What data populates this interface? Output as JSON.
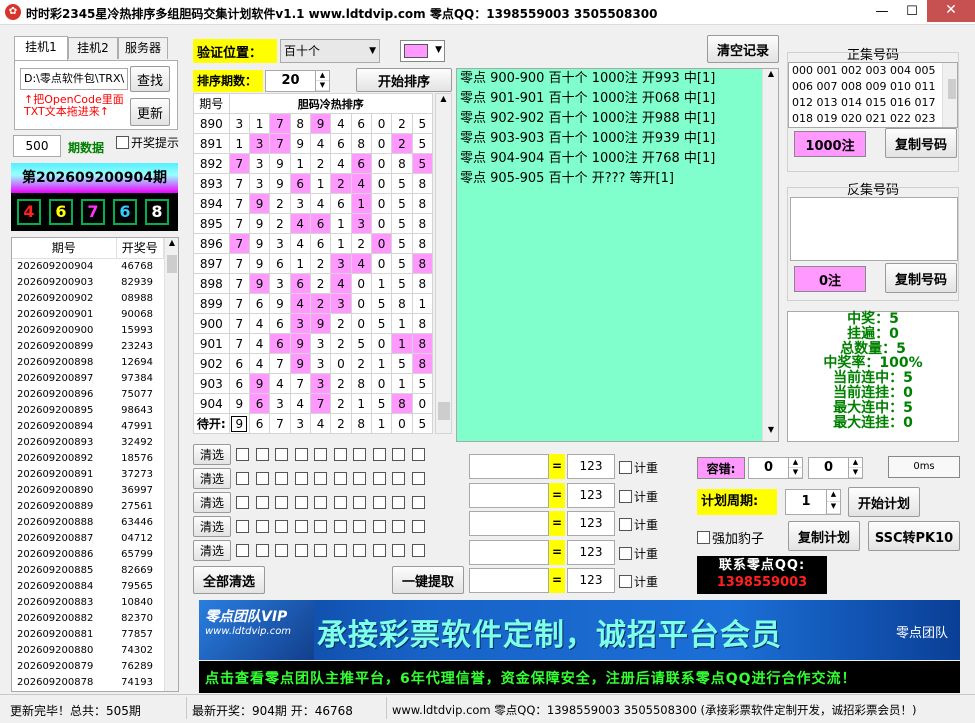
{
  "window": {
    "title": "时时彩2345星冷热排序多组胆码交集计划软件v1.1      www.ldtdvip.com      零点QQ：1398559003   3505508300",
    "app_icon": "app-logo-icon"
  },
  "left": {
    "tabs": [
      "挂机1",
      "挂机2",
      "服务器"
    ],
    "path": "D:\\零点软件包\\TRX\\",
    "find": "查找",
    "update": "更新",
    "hint1": "↑把OpenCode里面",
    "hint2": "TXT文本拖进来↑",
    "period_count": "500",
    "period_label": "期数据",
    "lottery_hint": "开奖提示",
    "current_issue": "第202609200904期",
    "digits": [
      {
        "d": "4",
        "c": "#ff2020"
      },
      {
        "d": "6",
        "c": "#ffff00"
      },
      {
        "d": "7",
        "c": "#ff33ff"
      },
      {
        "d": "6",
        "c": "#33ccff"
      },
      {
        "d": "8",
        "c": "#ffffff"
      }
    ],
    "hist_headers": [
      "期号",
      "开奖号"
    ],
    "history": [
      [
        "202609200904",
        "46768"
      ],
      [
        "202609200903",
        "82939"
      ],
      [
        "202609200902",
        "08988"
      ],
      [
        "202609200901",
        "90068"
      ],
      [
        "202609200900",
        "15993"
      ],
      [
        "202609200899",
        "23243"
      ],
      [
        "202609200898",
        "12694"
      ],
      [
        "202609200897",
        "97384"
      ],
      [
        "202609200896",
        "75077"
      ],
      [
        "202609200895",
        "98643"
      ],
      [
        "202609200894",
        "47991"
      ],
      [
        "202609200893",
        "32492"
      ],
      [
        "202609200892",
        "18576"
      ],
      [
        "202609200891",
        "37273"
      ],
      [
        "202609200890",
        "36997"
      ],
      [
        "202609200889",
        "27561"
      ],
      [
        "202609200888",
        "63446"
      ],
      [
        "202609200887",
        "04712"
      ],
      [
        "202609200886",
        "65799"
      ],
      [
        "202609200885",
        "82669"
      ],
      [
        "202609200884",
        "79565"
      ],
      [
        "202609200883",
        "10840"
      ],
      [
        "202609200882",
        "82370"
      ],
      [
        "202609200881",
        "77857"
      ],
      [
        "202609200880",
        "74302"
      ],
      [
        "202609200879",
        "76289"
      ],
      [
        "202609200878",
        "74193"
      ]
    ]
  },
  "mid": {
    "verify_label": "验证位置：",
    "verify_value": "百十个",
    "sort_label": "排序期数：",
    "sort_value": "20",
    "start_sort": "开始排序",
    "col_period": "期号",
    "col_title": "胆码冷热排序",
    "rows": [
      {
        "p": "890",
        "d": [
          "3",
          "1",
          "7",
          "8",
          "9",
          "4",
          "6",
          "0",
          "2",
          "5"
        ],
        "h": [
          2,
          4
        ]
      },
      {
        "p": "891",
        "d": [
          "1",
          "3",
          "7",
          "9",
          "4",
          "6",
          "8",
          "0",
          "2",
          "5"
        ],
        "h": [
          1,
          2,
          8
        ]
      },
      {
        "p": "892",
        "d": [
          "7",
          "3",
          "9",
          "1",
          "2",
          "4",
          "6",
          "0",
          "8",
          "5"
        ],
        "h": [
          0,
          6,
          9
        ]
      },
      {
        "p": "893",
        "d": [
          "7",
          "3",
          "9",
          "6",
          "1",
          "2",
          "4",
          "0",
          "5",
          "8"
        ],
        "h": [
          3,
          5,
          6
        ]
      },
      {
        "p": "894",
        "d": [
          "7",
          "9",
          "2",
          "3",
          "4",
          "6",
          "1",
          "0",
          "5",
          "8"
        ],
        "h": [
          1,
          6
        ]
      },
      {
        "p": "895",
        "d": [
          "7",
          "9",
          "2",
          "4",
          "6",
          "1",
          "3",
          "0",
          "5",
          "8"
        ],
        "h": [
          3,
          4,
          6
        ]
      },
      {
        "p": "896",
        "d": [
          "7",
          "9",
          "3",
          "4",
          "6",
          "1",
          "2",
          "0",
          "5",
          "8"
        ],
        "h": [
          0,
          7
        ]
      },
      {
        "p": "897",
        "d": [
          "7",
          "9",
          "6",
          "1",
          "2",
          "3",
          "4",
          "0",
          "5",
          "8"
        ],
        "h": [
          5,
          6,
          9
        ]
      },
      {
        "p": "898",
        "d": [
          "7",
          "9",
          "3",
          "6",
          "2",
          "4",
          "0",
          "1",
          "5",
          "8"
        ],
        "h": [
          1,
          3,
          5
        ]
      },
      {
        "p": "899",
        "d": [
          "7",
          "6",
          "9",
          "4",
          "2",
          "3",
          "0",
          "5",
          "8",
          "1"
        ],
        "h": [
          3,
          4,
          5
        ]
      },
      {
        "p": "900",
        "d": [
          "7",
          "4",
          "6",
          "3",
          "9",
          "2",
          "0",
          "5",
          "1",
          "8"
        ],
        "h": [
          3,
          4
        ]
      },
      {
        "p": "901",
        "d": [
          "7",
          "4",
          "6",
          "9",
          "3",
          "2",
          "5",
          "0",
          "1",
          "8"
        ],
        "h": [
          2,
          3,
          8,
          9
        ]
      },
      {
        "p": "902",
        "d": [
          "6",
          "4",
          "7",
          "9",
          "3",
          "0",
          "2",
          "1",
          "5",
          "8"
        ],
        "h": [
          3,
          9
        ]
      },
      {
        "p": "903",
        "d": [
          "6",
          "9",
          "4",
          "7",
          "3",
          "2",
          "8",
          "0",
          "1",
          "5"
        ],
        "h": [
          1,
          4
        ]
      },
      {
        "p": "904",
        "d": [
          "9",
          "6",
          "3",
          "4",
          "7",
          "2",
          "1",
          "5",
          "8",
          "0"
        ],
        "h": [
          1,
          4,
          8
        ]
      }
    ],
    "pending_label": "待开:",
    "pending": [
      "9",
      "6",
      "7",
      "3",
      "4",
      "2",
      "8",
      "1",
      "0",
      "5"
    ],
    "clear_labels": [
      "清选",
      "清选",
      "清选",
      "清选",
      "清选"
    ],
    "clear_all": "全部清选",
    "extract": "一键提取",
    "eq": "=",
    "formula_values": [
      "123",
      "123",
      "123",
      "123",
      "123"
    ],
    "recount": "计重"
  },
  "log": {
    "clear": "清空记录",
    "lines": [
      "零点 900-900 百十个 1000注 开993 中[1]",
      "零点 901-901 百十个 1000注 开068 中[1]",
      "零点 902-902 百十个 1000注 开988 中[1]",
      "零点 903-903 百十个 1000注 开939 中[1]",
      "零点 904-904 百十个 1000注 开768 中[1]",
      "零点 905-905 百十个 开???  等开[1]"
    ]
  },
  "right": {
    "pos_title": "正集号码",
    "pos_nums": [
      "000 001 002 003 004 005",
      "006 007 008 009 010 011",
      "012 013 014 015 016 017",
      "018 019 020 021 022 023"
    ],
    "pos_count": "1000注",
    "copy": "复制号码",
    "neg_title": "反集号码",
    "neg_count": "0注",
    "stats": [
      "中奖：5",
      "挂遍：0",
      "总数量：5",
      "中奖率：100%",
      "当前连中：5",
      "当前连挂：0",
      "最大连中：5",
      "最大连挂：0"
    ],
    "tolerance_label": "容错:",
    "tol1": "0",
    "tol2": "0",
    "ms": "0ms",
    "cycle_label": "计划周期:",
    "cycle_value": "1",
    "start_plan": "开始计划",
    "leopard": "强加豹子",
    "copy_plan": "复制计划",
    "ssc_pk": "SSC转PK10",
    "contact": "联系零点QQ:",
    "contact_qq": "1398559003"
  },
  "banner": {
    "team": "零点团队VIP",
    "site": "www.ldtdvip.com",
    "slogan": "承接彩票软件定制，诚招平台会员",
    "team2": "零点团队",
    "marquee": "点击查看零点团队主推平台，6年代理信誉，资金保障安全，注册后请联系零点QQ进行合作交流！"
  },
  "status": {
    "s1": "更新完毕！总共：505期",
    "s2": "最新开奖：904期 开：46768",
    "s3": "www.ldtdvip.com   零点QQ：1398559003  3505508300  (承接彩票软件定制开发，诚招彩票会员！)"
  },
  "colors": {
    "pink": "#ff99ff",
    "mint": "#80ffcc",
    "yellow": "#ffff00",
    "banner_blue": "#1a4aa0",
    "win_green": "#008000"
  }
}
